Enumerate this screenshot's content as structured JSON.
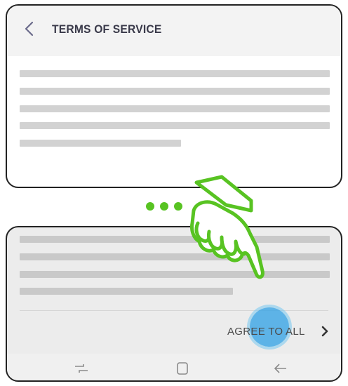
{
  "header": {
    "title": "TERMS OF SERVICE",
    "back_icon": "chevron-left-icon"
  },
  "agreement": {
    "agree_all_label": "AGREE TO ALL",
    "chevron_icon": "chevron-right-icon"
  },
  "navigation": {
    "icons": [
      "recent-apps-icon",
      "home-icon",
      "back-arrow-icon"
    ]
  },
  "illustration": {
    "gesture": "hand-pointer-icon",
    "ellipsis": "ellipsis-dots",
    "tap_indicator": "tap-ripple",
    "accent_color": "#58c322",
    "tap_color": "#2ea0e6"
  }
}
